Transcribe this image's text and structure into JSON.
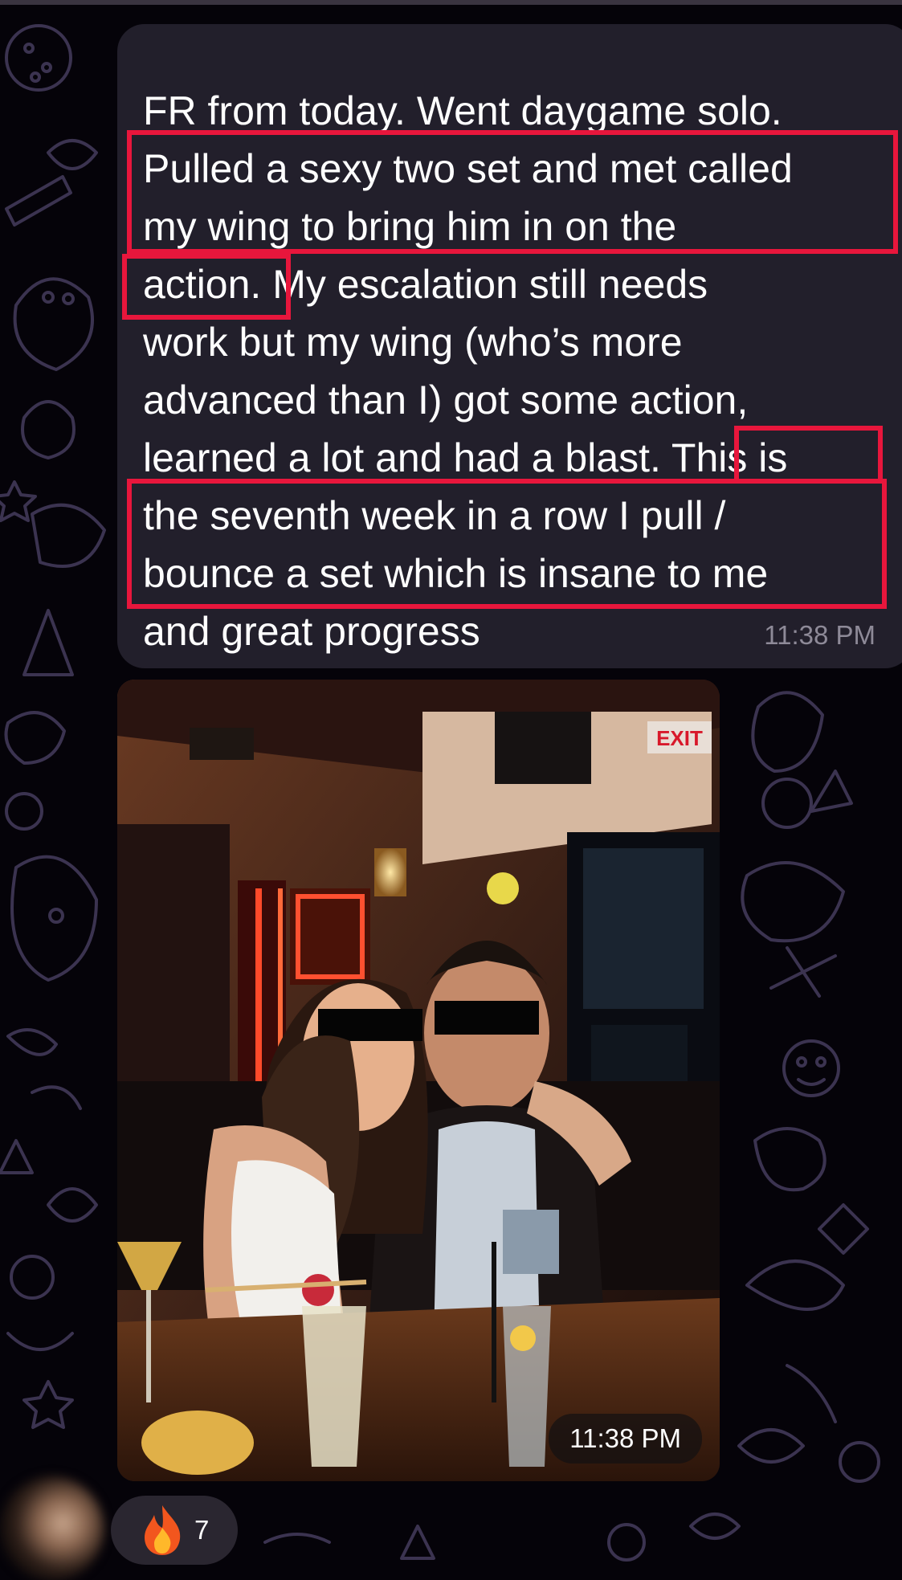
{
  "message": {
    "lines": [
      "FR from today. Went daygame solo.",
      "Pulled a sexy two set and met called",
      "my wing to bring him in on the",
      "action. My escalation still needs",
      "work but my wing (who’s more",
      "advanced than I) got some action,",
      "learned a lot and had a blast. This is",
      "the seventh week in a row I pull /",
      "bounce a set which is insane to me",
      "and great progress"
    ],
    "time": "11:38 PM"
  },
  "photo": {
    "description_icon": "photo-icon",
    "time": "11:38 PM",
    "exit_sign": "EXIT"
  },
  "reaction": {
    "emoji_icon": "fire-icon",
    "count": "7"
  },
  "colors": {
    "background": "#050309",
    "bubble": "#221f2b",
    "highlight": "#e8163c",
    "doodle": "#3b3350"
  }
}
